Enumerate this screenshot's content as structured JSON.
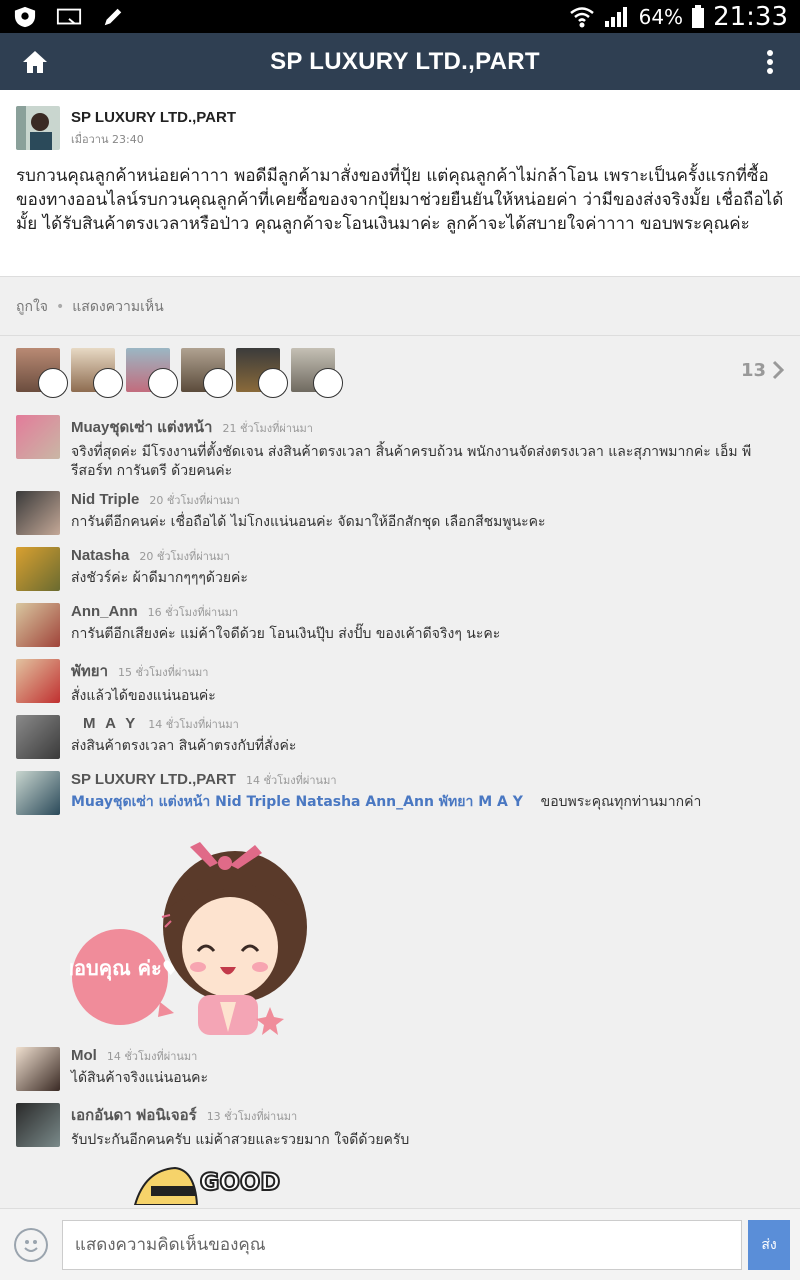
{
  "status_bar": {
    "battery": "64%",
    "time": "21:33"
  },
  "app_bar": {
    "title": "SP LUXURY LTD.,PART"
  },
  "post": {
    "author": "SP LUXURY LTD.,PART",
    "time": "เมื่อวาน 23:40",
    "text": "รบกวนคุณลูกค้าหน่อยค่าาาา พอดีมีลูกค้ามาสั่งของที่ปุ้ย แต่คุณลูกค้าไม่กล้าโอน เพราะเป็นครั้งแรกที่ซื้อของทางออนไลน์รบกวนคุณลูกค้าที่เคยซื้อของจากปุ้ยมาช่วยยืนยันให้หน่อยค่า ว่ามีของส่งจริงมั้ย เชื่อถือได้มั้ย ได้รับสินค้าตรงเวลาหรือป่าว คุณลูกค้าจะโอนเงินมาค่ะ ลูกค้าจะได้สบายใจค่าาาา ขอบพระคุณค่ะ"
  },
  "actions": {
    "like": "ถูกใจ",
    "comment": "แสดงความเห็น"
  },
  "likes": {
    "count": "13"
  },
  "comments": [
    {
      "name": "Muayชุดเซ่า แต่งหน้า",
      "time": "21 ชั่วโมงที่ผ่านมา",
      "text": "จริงที่สุดค่ะ  มีโรงงานที่ตั้งชัดเจน ส่งสินค้าตรงเวลา สิ้นค้าครบถ้วน พนักงานจัดส่งตรงเวลา  และสุภาพมากค่ะ   เอ็ม พี รีสอร์ท การันตรี ด้วยคนค่ะ"
    },
    {
      "name": "Nid Triple",
      "time": "20 ชั่วโมงที่ผ่านมา",
      "text": "การันตีอีกคนค่ะ เชื่อถือได้ ไม่โกงแน่นอนค่ะ จัดมาให้อีกสักชุด เลือกสีชมพูนะคะ"
    },
    {
      "name": "Natasha",
      "time": "20 ชั่วโมงที่ผ่านมา",
      "text": "ส่งชัวร์ค่ะ  ผ้าดีมากๆๆๆด้วยค่ะ"
    },
    {
      "name": "Ann_Ann",
      "time": "16 ชั่วโมงที่ผ่านมา",
      "text": "การันตีอีกเสียงค่ะ แม่ค้าใจดีด้วย โอนเงินปุ๊บ ส่งปั๊บ ของเค้าดีจริงๆ นะคะ"
    },
    {
      "name": "พัทยา",
      "time": "15 ชั่วโมงที่ผ่านมา",
      "text": "สั่งแล้วได้ของแน่นอนค่ะ"
    },
    {
      "name": "M A Y",
      "time": "14 ชั่วโมงที่ผ่านมา",
      "text": "ส่งสินค้าตรงเวลา สินค้าตรงกับที่สั่งค่ะ"
    },
    {
      "name": "SP LUXURY LTD.,PART",
      "time": "14 ชั่วโมงที่ผ่านมา",
      "tags": "Muayชุดเซ่า แต่งหน้า Nid Triple Natasha Ann_Ann พัทยา    M A Y",
      "text": "ขอบพระคุณทุกท่านมากค่า"
    },
    {
      "name": "Mol",
      "time": "14 ชั่วโมงที่ผ่านมา",
      "text": "ได้สินค้าจริงแน่นอนคะ"
    },
    {
      "name": "เอกอันดา ฟอนิเจอร์",
      "time": "13 ชั่วโมงที่ผ่านมา",
      "text": "รับประกันอีกคนครับ แม่ค้าสวยและรวยมาก ใจดีด้วยครับ"
    }
  ],
  "stickers": {
    "thanks_text": "ขอบคุณ ค่ะ♥",
    "good_text": "GOOD"
  },
  "input": {
    "placeholder": "แสดงความคิดเห็นของคุณ",
    "send": "ส่ง"
  },
  "colors": {
    "app_bar": "#2f3f52",
    "tag_link": "#4a78c2",
    "send_button": "#5a8ed8"
  }
}
